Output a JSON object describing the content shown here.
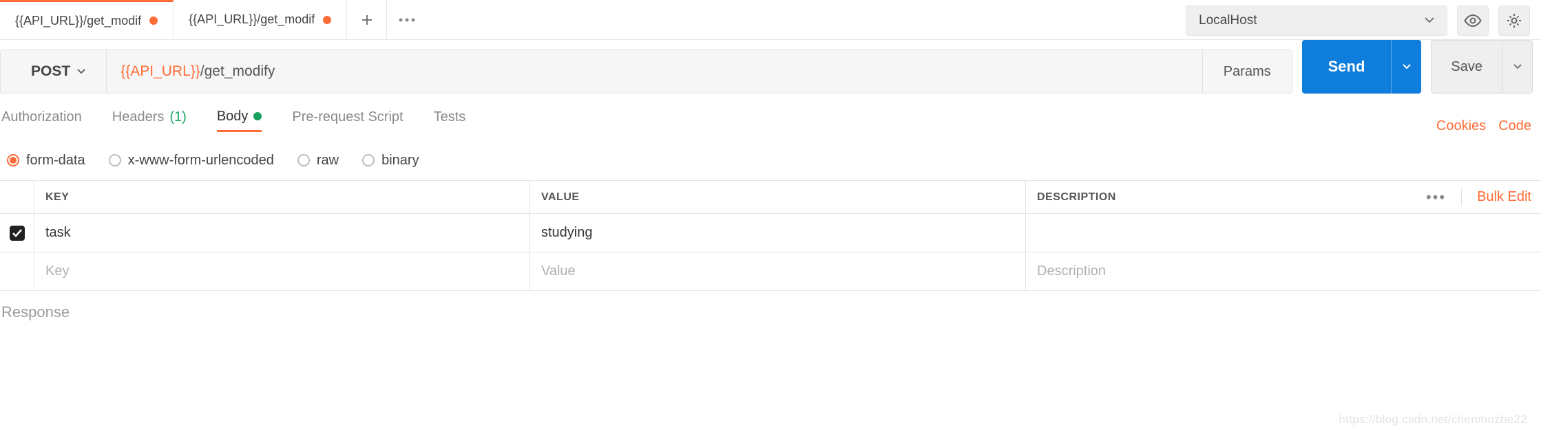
{
  "tabs": [
    {
      "label": "{{API_URL}}/get_modif",
      "unsaved": true
    },
    {
      "label": "{{API_URL}}/get_modif",
      "unsaved": true
    }
  ],
  "environment": {
    "selected": "LocalHost"
  },
  "request": {
    "method": "POST",
    "url_var": "{{API_URL}}",
    "url_rest": "/get_modify",
    "params_label": "Params",
    "send_label": "Send",
    "save_label": "Save"
  },
  "sections": {
    "authorization": "Authorization",
    "headers": "Headers",
    "headers_count": "(1)",
    "body": "Body",
    "prerequest": "Pre-request Script",
    "tests": "Tests",
    "cookies": "Cookies",
    "code": "Code"
  },
  "body_types": {
    "form_data": "form-data",
    "urlencoded": "x-www-form-urlencoded",
    "raw": "raw",
    "binary": "binary"
  },
  "table": {
    "headers": {
      "key": "KEY",
      "value": "VALUE",
      "description": "DESCRIPTION"
    },
    "rows": [
      {
        "key": "task",
        "value": "studying",
        "description": ""
      }
    ],
    "placeholders": {
      "key": "Key",
      "value": "Value",
      "description": "Description"
    },
    "bulk_edit": "Bulk Edit"
  },
  "response_label": "Response",
  "watermark": "https://blog.csdn.net/chenmozhe22"
}
